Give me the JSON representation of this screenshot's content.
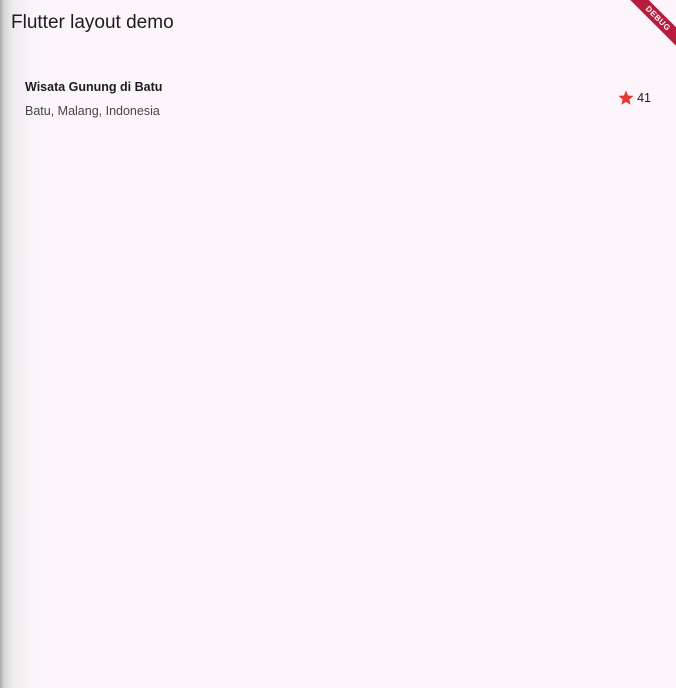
{
  "app_bar": {
    "title": "Flutter layout demo"
  },
  "place": {
    "name": "Wisata Gunung di Batu",
    "location": "Batu, Malang, Indonesia",
    "rating": {
      "icon": "star-icon",
      "icon_color": "#e53935",
      "count": "41"
    }
  },
  "debug_banner": {
    "label": "DEBUG",
    "color": "#b71c3c"
  },
  "colors": {
    "background": "#fcf6fc",
    "text_primary": "#1d1b20",
    "text_secondary": "#49454f"
  }
}
